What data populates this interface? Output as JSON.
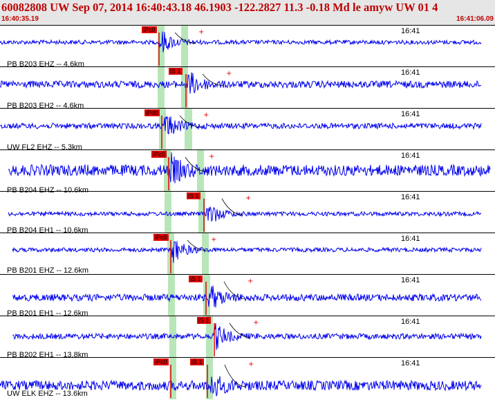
{
  "header": {
    "title": "60082808 UW Sep 07, 2014 16:40:43.18   46.1903 -122.2827 11.3 -0.18 Md le amyw UW 01    4",
    "start_time": "16:40:35.19",
    "end_time": "16:41:06.09"
  },
  "colors": {
    "trace": "#0000ee",
    "pick": "#e00000",
    "header_text": "#c00000",
    "window": "#b8e6b8"
  },
  "panels": [
    {
      "station": "PB B203 EHZ -- 4.6km",
      "time_label": "16:41",
      "picks": [
        {
          "label": "iPc0"
        }
      ]
    },
    {
      "station": "PB B203 EH2 -- 4.6km",
      "time_label": "16:41",
      "picks": [
        {
          "label": "iS 1"
        }
      ]
    },
    {
      "station": "UW FL2 EHZ -- 5.3km",
      "time_label": "16:41",
      "picks": [
        {
          "label": "iPd0"
        }
      ]
    },
    {
      "station": "PB B204 EHZ -- 10.6km",
      "time_label": "16:41",
      "picks": [
        {
          "label": "iPc0"
        }
      ]
    },
    {
      "station": "PB B204 EH1 -- 10.6km",
      "time_label": "16:41",
      "picks": [
        {
          "label": "iS 1"
        }
      ]
    },
    {
      "station": "PB B201 EHZ -- 12.6km",
      "time_label": "16:41",
      "picks": [
        {
          "label": "iPc0"
        }
      ]
    },
    {
      "station": "PB B201 EH1 -- 12.6km",
      "time_label": "16:41",
      "picks": [
        {
          "label": "iS 1"
        }
      ]
    },
    {
      "station": "PB B202 EH1 -- 13.8km",
      "time_label": "16:41",
      "picks": [
        {
          "label": "iS 1"
        }
      ]
    },
    {
      "station": "UW ELK EHZ -- 13.6km",
      "time_label": "16:41",
      "picks": [
        {
          "label": "iPc0"
        },
        {
          "label": "iS 1"
        }
      ]
    }
  ]
}
